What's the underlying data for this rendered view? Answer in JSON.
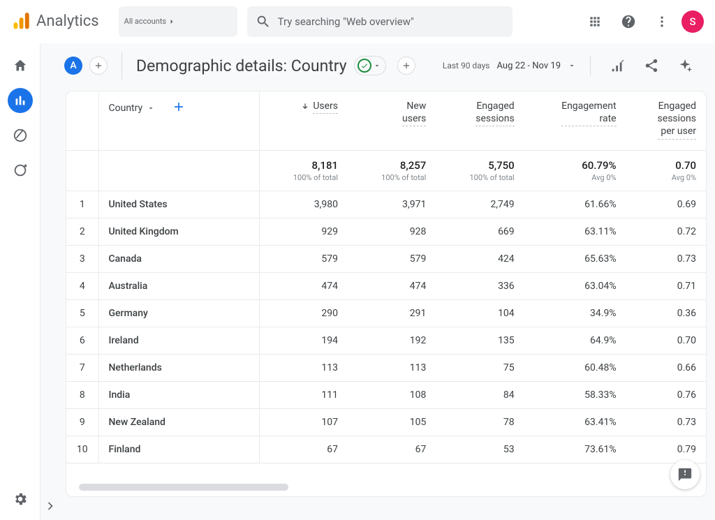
{
  "header": {
    "product": "Analytics",
    "breadcrumb": "All accounts",
    "search_placeholder": "Try searching \"Web overview\"",
    "avatar_letter": "S"
  },
  "report": {
    "segment_chip": "A",
    "title": "Demographic details: Country",
    "date_label": "Last 90 days",
    "date_range": "Aug 22 - Nov 19"
  },
  "table": {
    "dimension_label": "Country",
    "columns": [
      "Users",
      "New\nusers",
      "Engaged\nsessions",
      "Engagement\nrate",
      "Engaged\nsessions\nper user"
    ],
    "totals": {
      "values": [
        "8,181",
        "8,257",
        "5,750",
        "60.79%",
        "0.70"
      ],
      "subs": [
        "100% of total",
        "100% of total",
        "100% of total",
        "Avg 0%",
        "Avg 0%"
      ]
    },
    "rows": [
      {
        "rank": 1,
        "dim": "United States",
        "v": [
          "3,980",
          "3,971",
          "2,749",
          "61.66%",
          "0.69"
        ]
      },
      {
        "rank": 2,
        "dim": "United Kingdom",
        "v": [
          "929",
          "928",
          "669",
          "63.11%",
          "0.72"
        ]
      },
      {
        "rank": 3,
        "dim": "Canada",
        "v": [
          "579",
          "579",
          "424",
          "65.63%",
          "0.73"
        ]
      },
      {
        "rank": 4,
        "dim": "Australia",
        "v": [
          "474",
          "474",
          "336",
          "63.04%",
          "0.71"
        ]
      },
      {
        "rank": 5,
        "dim": "Germany",
        "v": [
          "290",
          "291",
          "104",
          "34.9%",
          "0.36"
        ]
      },
      {
        "rank": 6,
        "dim": "Ireland",
        "v": [
          "194",
          "192",
          "135",
          "64.9%",
          "0.70"
        ]
      },
      {
        "rank": 7,
        "dim": "Netherlands",
        "v": [
          "113",
          "113",
          "75",
          "60.48%",
          "0.66"
        ]
      },
      {
        "rank": 8,
        "dim": "India",
        "v": [
          "111",
          "108",
          "84",
          "58.33%",
          "0.76"
        ]
      },
      {
        "rank": 9,
        "dim": "New Zealand",
        "v": [
          "107",
          "105",
          "78",
          "63.41%",
          "0.73"
        ]
      },
      {
        "rank": 10,
        "dim": "Finland",
        "v": [
          "67",
          "67",
          "53",
          "73.61%",
          "0.79"
        ]
      }
    ]
  },
  "chart_data": {
    "type": "table",
    "dimension": "Country",
    "metrics": [
      "Users",
      "New users",
      "Engaged sessions",
      "Engagement rate",
      "Engaged sessions per user"
    ],
    "totals": {
      "Users": 8181,
      "New users": 8257,
      "Engaged sessions": 5750,
      "Engagement rate": 0.6079,
      "Engaged sessions per user": 0.7
    },
    "rows": [
      {
        "Country": "United States",
        "Users": 3980,
        "New users": 3971,
        "Engaged sessions": 2749,
        "Engagement rate": 0.6166,
        "Engaged sessions per user": 0.69
      },
      {
        "Country": "United Kingdom",
        "Users": 929,
        "New users": 928,
        "Engaged sessions": 669,
        "Engagement rate": 0.6311,
        "Engaged sessions per user": 0.72
      },
      {
        "Country": "Canada",
        "Users": 579,
        "New users": 579,
        "Engaged sessions": 424,
        "Engagement rate": 0.6563,
        "Engaged sessions per user": 0.73
      },
      {
        "Country": "Australia",
        "Users": 474,
        "New users": 474,
        "Engaged sessions": 336,
        "Engagement rate": 0.6304,
        "Engaged sessions per user": 0.71
      },
      {
        "Country": "Germany",
        "Users": 290,
        "New users": 291,
        "Engaged sessions": 104,
        "Engagement rate": 0.349,
        "Engaged sessions per user": 0.36
      },
      {
        "Country": "Ireland",
        "Users": 194,
        "New users": 192,
        "Engaged sessions": 135,
        "Engagement rate": 0.649,
        "Engaged sessions per user": 0.7
      },
      {
        "Country": "Netherlands",
        "Users": 113,
        "New users": 113,
        "Engaged sessions": 75,
        "Engagement rate": 0.6048,
        "Engaged sessions per user": 0.66
      },
      {
        "Country": "India",
        "Users": 111,
        "New users": 108,
        "Engaged sessions": 84,
        "Engagement rate": 0.5833,
        "Engaged sessions per user": 0.76
      },
      {
        "Country": "New Zealand",
        "Users": 107,
        "New users": 105,
        "Engaged sessions": 78,
        "Engagement rate": 0.6341,
        "Engaged sessions per user": 0.73
      },
      {
        "Country": "Finland",
        "Users": 67,
        "New users": 67,
        "Engaged sessions": 53,
        "Engagement rate": 0.7361,
        "Engaged sessions per user": 0.79
      }
    ],
    "date_range": "Aug 22 - Nov 19 (Last 90 days)"
  }
}
